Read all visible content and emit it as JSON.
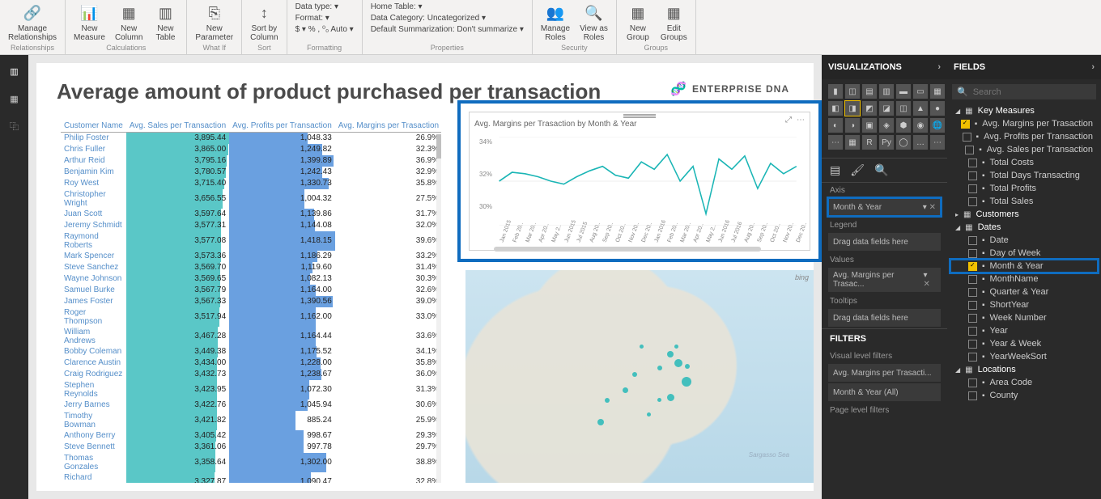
{
  "ribbon": {
    "groups": [
      {
        "name": "Relationships",
        "items": [
          {
            "label": "Manage\nRelationships",
            "icon": "🔗"
          }
        ]
      },
      {
        "name": "Calculations",
        "items": [
          {
            "label": "New\nMeasure",
            "icon": "📊"
          },
          {
            "label": "New\nColumn",
            "icon": "▦"
          },
          {
            "label": "New\nTable",
            "icon": "▥"
          }
        ]
      },
      {
        "name": "What If",
        "items": [
          {
            "label": "New\nParameter",
            "icon": "⎘"
          }
        ]
      },
      {
        "name": "Sort",
        "items": [
          {
            "label": "Sort by\nColumn",
            "icon": "↕"
          }
        ]
      },
      {
        "name": "Formatting",
        "rows": [
          "Data type: ▾",
          "Format: ▾",
          "$ ▾ % , ⁰₀ Auto ▾"
        ]
      },
      {
        "name": "Properties",
        "rows": [
          "Home Table: ▾",
          "Data Category: Uncategorized ▾",
          "Default Summarization: Don't summarize ▾"
        ]
      },
      {
        "name": "Security",
        "items": [
          {
            "label": "Manage\nRoles",
            "icon": "👥"
          },
          {
            "label": "View as\nRoles",
            "icon": "🔍"
          }
        ]
      },
      {
        "name": "Groups",
        "items": [
          {
            "label": "New\nGroup",
            "icon": "▦"
          },
          {
            "label": "Edit\nGroups",
            "icon": "▦"
          }
        ]
      }
    ]
  },
  "title": "Average amount of product purchased per transaction",
  "brand": "ENTERPRISE DNA",
  "table": {
    "headers": [
      "Customer Name",
      "Avg. Sales per Transaction",
      "Avg. Profits per Transaction",
      "Avg. Margins per Trasaction"
    ],
    "rows": [
      [
        "Philip Foster",
        "3,895.44",
        "1,048.33",
        "26.9%"
      ],
      [
        "Chris Fuller",
        "3,865.00",
        "1,249.82",
        "32.3%"
      ],
      [
        "Arthur Reid",
        "3,795.16",
        "1,399.89",
        "36.9%"
      ],
      [
        "Benjamin Kim",
        "3,780.57",
        "1,242.43",
        "32.9%"
      ],
      [
        "Roy West",
        "3,715.40",
        "1,330.73",
        "35.8%"
      ],
      [
        "Christopher Wright",
        "3,656.55",
        "1,004.32",
        "27.5%"
      ],
      [
        "Juan Scott",
        "3,597.64",
        "1,139.86",
        "31.7%"
      ],
      [
        "Jeremy Schmidt",
        "3,577.31",
        "1,144.08",
        "32.0%"
      ],
      [
        "Raymond Roberts",
        "3,577.08",
        "1,418.15",
        "39.6%"
      ],
      [
        "Mark Spencer",
        "3,573.36",
        "1,186.29",
        "33.2%"
      ],
      [
        "Steve Sanchez",
        "3,569.70",
        "1,119.60",
        "31.4%"
      ],
      [
        "Wayne Johnson",
        "3,569.65",
        "1,082.13",
        "30.3%"
      ],
      [
        "Samuel Burke",
        "3,567.79",
        "1,164.00",
        "32.6%"
      ],
      [
        "James Foster",
        "3,567.33",
        "1,390.56",
        "39.0%"
      ],
      [
        "Roger Thompson",
        "3,517.94",
        "1,162.00",
        "33.0%"
      ],
      [
        "William Andrews",
        "3,467.28",
        "1,164.44",
        "33.6%"
      ],
      [
        "Bobby Coleman",
        "3,449.38",
        "1,175.52",
        "34.1%"
      ],
      [
        "Clarence Austin",
        "3,434.00",
        "1,228.00",
        "35.8%"
      ],
      [
        "Craig Rodriguez",
        "3,432.73",
        "1,238.67",
        "36.0%"
      ],
      [
        "Stephen Reynolds",
        "3,423.95",
        "1,072.30",
        "31.3%"
      ],
      [
        "Jerry Barnes",
        "3,422.76",
        "1,045.94",
        "30.6%"
      ],
      [
        "Timothy Bowman",
        "3,421.82",
        "885.24",
        "25.9%"
      ],
      [
        "Anthony Berry",
        "3,405.42",
        "998.67",
        "29.3%"
      ],
      [
        "Steve Bennett",
        "3,361.06",
        "997.78",
        "29.7%"
      ],
      [
        "Thomas Gonzales",
        "3,358.64",
        "1,302.00",
        "38.8%"
      ],
      [
        "Richard Peterson",
        "3,327.87",
        "1,090.47",
        "32.8%"
      ]
    ],
    "sales_max": 3895.44,
    "profits_max": 1418.15
  },
  "chart": {
    "title": "Avg. Margins per Trasaction by Month & Year",
    "y_labels": [
      "34%",
      "32%",
      "30%"
    ]
  },
  "chart_data": {
    "type": "line",
    "title": "Avg. Margins per Trasaction by Month & Year",
    "xlabel": "Month & Year",
    "ylabel": "Avg. Margins per Trasaction",
    "ylim": [
      29,
      35
    ],
    "categories": [
      "Jan 2015",
      "Feb 20..",
      "Mar 20..",
      "Apr 20..",
      "May 2..",
      "Jun 2015",
      "Jul 2015",
      "Aug 20..",
      "Sep 20..",
      "Oct 20..",
      "Nov 20..",
      "Dec 20..",
      "Jan 2016",
      "Feb 20..",
      "Mar 20..",
      "Apr 20..",
      "May 2..",
      "Jun 2016",
      "Jul 2016",
      "Aug 20..",
      "Sep 20..",
      "Oct 20..",
      "Nov 20..",
      "Dec 20.."
    ],
    "values": [
      32.0,
      32.6,
      32.5,
      32.3,
      32.0,
      31.8,
      32.3,
      32.7,
      33.0,
      32.4,
      32.2,
      33.3,
      32.8,
      33.8,
      32.0,
      33.0,
      29.8,
      33.5,
      32.8,
      33.7,
      31.5,
      33.2,
      32.5,
      33.0
    ]
  },
  "map": {
    "label": "Sargasso Sea",
    "attribution": "bing"
  },
  "viz": {
    "header": "VISUALIZATIONS",
    "wells": {
      "axis": {
        "label": "Axis",
        "value": "Month & Year"
      },
      "legend": {
        "label": "Legend",
        "placeholder": "Drag data fields here"
      },
      "values": {
        "label": "Values",
        "value": "Avg. Margins per Trasac..."
      },
      "tooltips": {
        "label": "Tooltips",
        "placeholder": "Drag data fields here"
      }
    },
    "filters_hdr": "FILTERS",
    "filters": {
      "visual_label": "Visual level filters",
      "f1": "Avg. Margins per Trasacti...",
      "f2": "Month & Year (All)",
      "page_label": "Page level filters"
    }
  },
  "fields": {
    "header": "FIELDS",
    "search_placeholder": "Search",
    "tables": {
      "key_measures": {
        "label": "Key Measures",
        "items": [
          {
            "checked": true,
            "label": "Avg. Margins per Trasaction"
          },
          {
            "checked": false,
            "label": "Avg. Profits per Transaction"
          },
          {
            "checked": false,
            "label": "Avg. Sales per Transaction"
          },
          {
            "checked": false,
            "label": "Total Costs"
          },
          {
            "checked": false,
            "label": "Total Days Transacting"
          },
          {
            "checked": false,
            "label": "Total Profits"
          },
          {
            "checked": false,
            "label": "Total Sales"
          }
        ]
      },
      "customers": {
        "label": "Customers"
      },
      "dates": {
        "label": "Dates",
        "items": [
          {
            "checked": false,
            "label": "Date"
          },
          {
            "checked": false,
            "label": "Day of Week"
          },
          {
            "checked": true,
            "label": "Month & Year",
            "hl": true
          },
          {
            "checked": false,
            "label": "MonthName"
          },
          {
            "checked": false,
            "label": "Quarter & Year"
          },
          {
            "checked": false,
            "label": "ShortYear"
          },
          {
            "checked": false,
            "label": "Week Number"
          },
          {
            "checked": false,
            "label": "Year"
          },
          {
            "checked": false,
            "label": "Year & Week"
          },
          {
            "checked": false,
            "label": "YearWeekSort"
          }
        ]
      },
      "locations": {
        "label": "Locations",
        "items": [
          {
            "checked": false,
            "label": "Area Code"
          },
          {
            "checked": false,
            "label": "County"
          }
        ]
      }
    }
  }
}
